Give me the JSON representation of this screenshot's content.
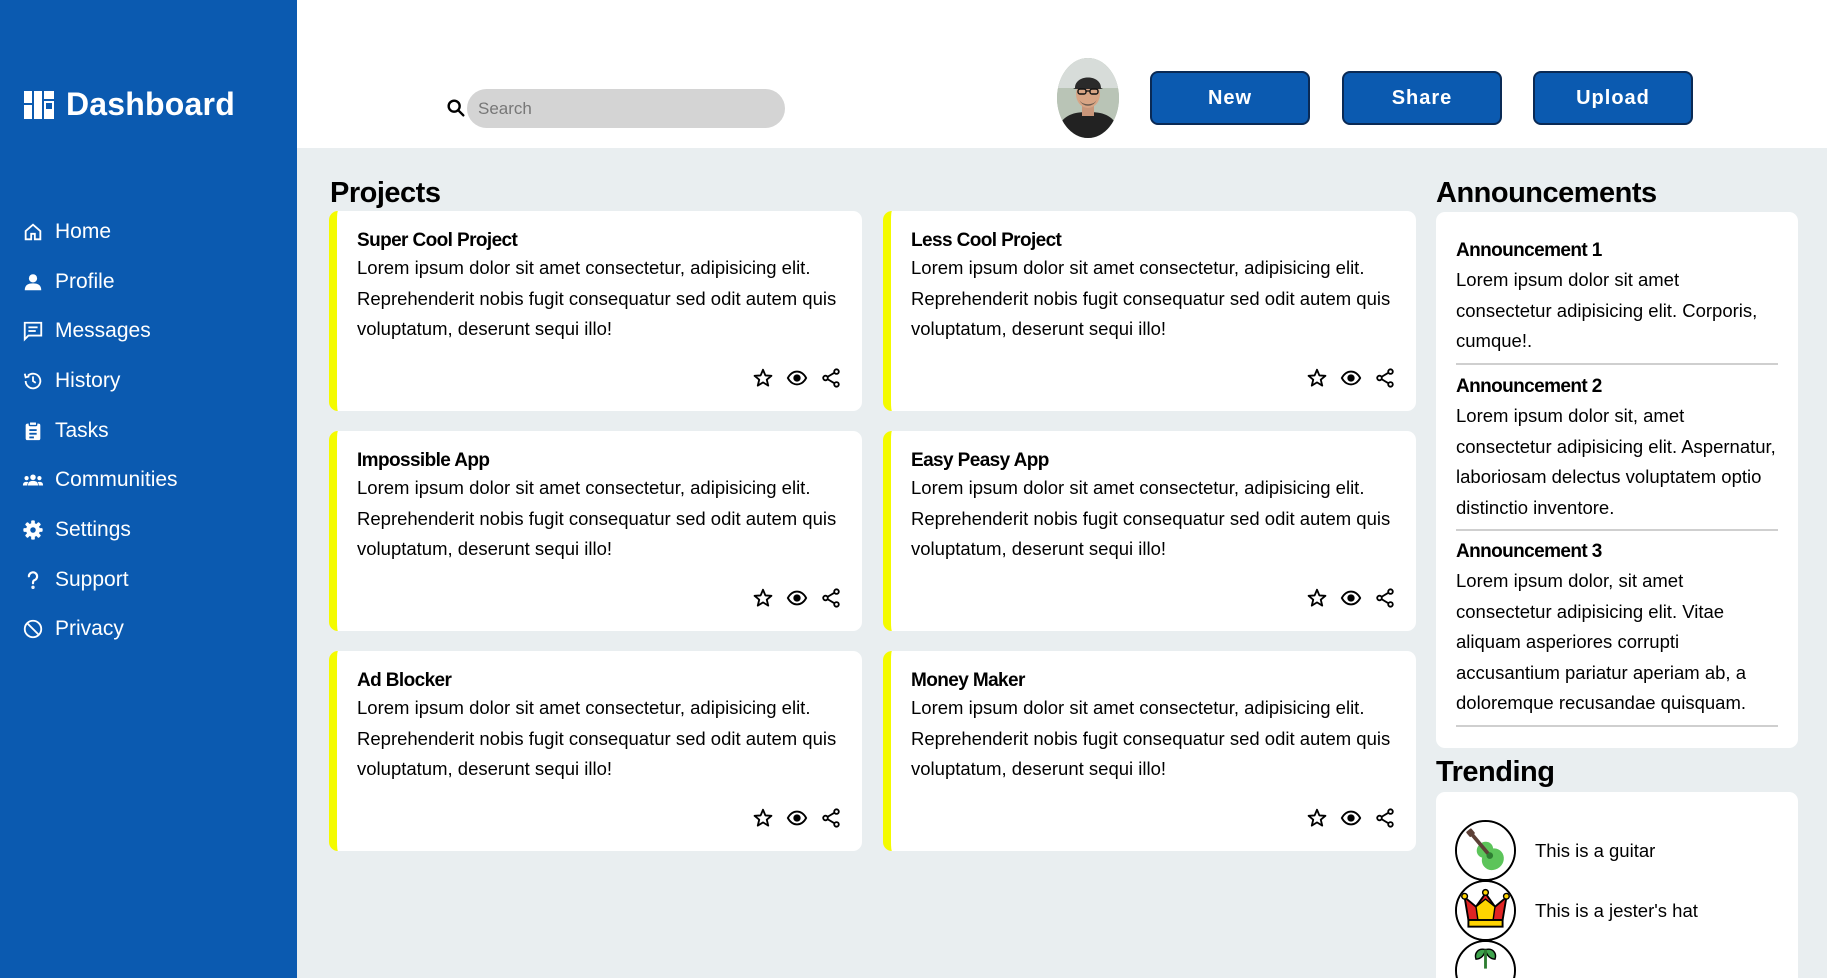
{
  "sidebar": {
    "brand": {
      "title": "Dashboard",
      "icon": "dashboard-icon"
    },
    "items": [
      {
        "label": "Home",
        "icon": "home-icon"
      },
      {
        "label": "Profile",
        "icon": "person-icon"
      },
      {
        "label": "Messages",
        "icon": "message-icon"
      },
      {
        "label": "History",
        "icon": "history-icon"
      },
      {
        "label": "Tasks",
        "icon": "clipboard-icon"
      },
      {
        "label": "Communities",
        "icon": "group-icon"
      },
      {
        "label": "Settings",
        "icon": "gear-icon"
      },
      {
        "label": "Support",
        "icon": "question-icon"
      },
      {
        "label": "Privacy",
        "icon": "block-icon"
      }
    ]
  },
  "header": {
    "search": {
      "placeholder": "Search",
      "value": ""
    },
    "buttons": {
      "new": "New",
      "share": "Share",
      "upload": "Upload"
    }
  },
  "projects": {
    "title": "Projects",
    "items": [
      {
        "title": "Super Cool Project",
        "body": "Lorem ipsum dolor sit amet consectetur, adipisicing elit. Reprehenderit nobis fugit consequatur sed odit autem quis voluptatum, deserunt sequi illo!"
      },
      {
        "title": "Less Cool Project",
        "body": "Lorem ipsum dolor sit amet consectetur, adipisicing elit. Reprehenderit nobis fugit consequatur sed odit autem quis voluptatum, deserunt sequi illo!"
      },
      {
        "title": "Impossible App",
        "body": "Lorem ipsum dolor sit amet consectetur, adipisicing elit. Reprehenderit nobis fugit consequatur sed odit autem quis voluptatum, deserunt sequi illo!"
      },
      {
        "title": "Easy Peasy App",
        "body": "Lorem ipsum dolor sit amet consectetur, adipisicing elit. Reprehenderit nobis fugit consequatur sed odit autem quis voluptatum, deserunt sequi illo!"
      },
      {
        "title": "Ad Blocker",
        "body": "Lorem ipsum dolor sit amet consectetur, adipisicing elit. Reprehenderit nobis fugit consequatur sed odit autem quis voluptatum, deserunt sequi illo!"
      },
      {
        "title": "Money Maker",
        "body": "Lorem ipsum dolor sit amet consectetur, adipisicing elit. Reprehenderit nobis fugit consequatur sed odit autem quis voluptatum, deserunt sequi illo!"
      }
    ],
    "card_accent": "#f4fb00",
    "card_actions": [
      "star-icon",
      "eye-icon",
      "share-icon"
    ]
  },
  "announcements": {
    "title": "Announcements",
    "items": [
      {
        "title": "Announcement 1",
        "body": "Lorem ipsum dolor sit amet consectetur adipisicing elit. Corporis, cumque!."
      },
      {
        "title": "Announcement 2",
        "body": "Lorem ipsum dolor sit, amet consectetur adipisicing elit. Aspernatur, laboriosam delectus voluptatem optio distinctio inventore."
      },
      {
        "title": "Announcement 3",
        "body": "Lorem ipsum dolor, sit amet consectetur adipisicing elit. Vitae aliquam asperiores corrupti accusantium pariatur aperiam ab, a doloremque recusandae quisquam."
      }
    ]
  },
  "trending": {
    "title": "Trending",
    "items": [
      {
        "label": "This is a guitar",
        "icon": "guitar-icon"
      },
      {
        "label": "This is a jester's hat",
        "icon": "jester-hat-icon"
      },
      {
        "label": "",
        "icon": "plant-icon"
      }
    ]
  },
  "colors": {
    "brand": "#0b5ab0",
    "page_background": "#e9eef0",
    "card_background": "#ffffff",
    "accent": "#f4fb00"
  }
}
